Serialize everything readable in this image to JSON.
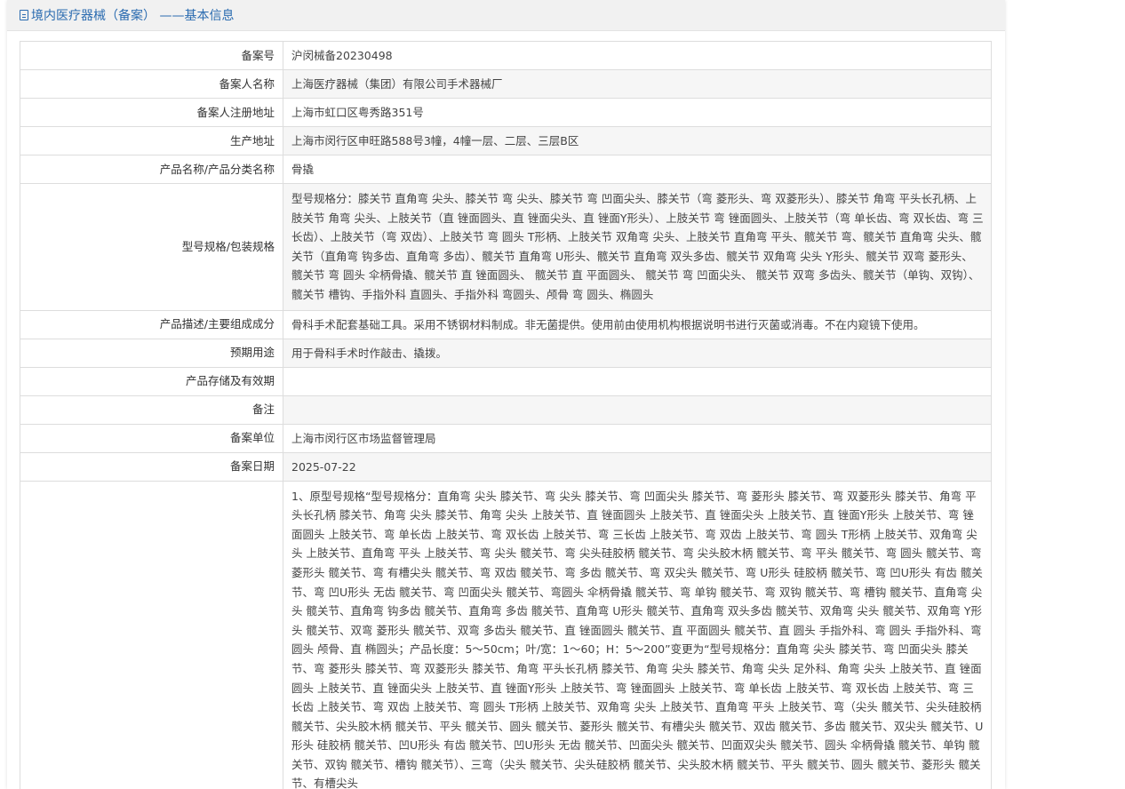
{
  "header": {
    "title": "境内医疗器械（备案） ——基本信息",
    "icon": "document-icon",
    "accent_color": "#2a6bb0"
  },
  "rows": [
    {
      "label": "备案号",
      "value": "沪闵械备20230498"
    },
    {
      "label": "备案人名称",
      "value": "上海医疗器械（集团）有限公司手术器械厂"
    },
    {
      "label": "备案人注册地址",
      "value": "上海市虹口区粤秀路351号"
    },
    {
      "label": "生产地址",
      "value": "上海市闵行区申旺路588号3幢，4幢一层、二层、三层B区"
    },
    {
      "label": "产品名称/产品分类名称",
      "value": "骨撬"
    },
    {
      "label": "型号规格/包装规格",
      "value": "型号规格分：膝关节 直角弯 尖头、膝关节 弯 尖头、膝关节 弯 凹面尖头、膝关节（弯 菱形头、弯 双菱形头）、膝关节 角弯 平头长孔柄、上肢关节 角弯 尖头、上肢关节（直 锉面圆头、直 锉面尖头、直 锉面Y形头）、上肢关节 弯 锉面圆头、上肢关节（弯 单长齿、弯 双长齿、弯 三长齿）、上肢关节（弯 双齿）、上肢关节 弯 圆头 T形柄、上肢关节 双角弯 尖头、上肢关节 直角弯 平头、髋关节 弯、髋关节 直角弯 尖头、髋关节（直角弯 钩多齿、直角弯 多齿）、髋关节 直角弯 U形头、髋关节 直角弯 双头多齿、髋关节 双角弯 尖头 Y形头、髋关节 双弯 菱形头、髋关节 弯 圆头 伞柄骨撬、髋关节 直 锉面圆头、 髋关节 直 平面圆头、 髋关节 弯 凹面尖头、 髋关节 双弯 多齿头、髋关节（单钩、双钩）、髋关节 槽钩、手指外科 直圆头、手指外科 弯圆头、颅骨 弯 圆头、椭圆头"
    },
    {
      "label": "产品描述/主要组成成分",
      "value": "骨科手术配套基础工具。采用不锈钢材料制成。非无菌提供。使用前由使用机构根据说明书进行灭菌或消毒。不在内窥镜下使用。"
    },
    {
      "label": "预期用途",
      "value": "用于骨科手术时作敲击、撬拨。"
    },
    {
      "label": "产品存储及有效期",
      "value": ""
    },
    {
      "label": "备注",
      "value": ""
    },
    {
      "label": "备案单位",
      "value": "上海市闵行区市场监督管理局"
    },
    {
      "label": "备案日期",
      "value": "2025-07-22"
    },
    {
      "label": "",
      "value": "1、原型号规格“型号规格分：直角弯 尖头 膝关节、弯 尖头 膝关节、弯 凹面尖头 膝关节、弯 菱形头 膝关节、弯 双菱形头 膝关节、角弯 平头长孔柄 膝关节、角弯 尖头 膝关节、角弯 尖头 上肢关节、直 锉面圆头 上肢关节、直 锉面尖头 上肢关节、直 锉面Y形头 上肢关节、弯 锉面圆头 上肢关节、弯 单长齿 上肢关节、弯 双长齿 上肢关节、弯 三长齿 上肢关节、弯 双齿 上肢关节、弯 圆头 T形柄 上肢关节、双角弯 尖头 上肢关节、直角弯 平头 上肢关节、弯 尖头 髋关节、弯 尖头硅胶柄 髋关节、弯 尖头胶木柄 髋关节、弯 平头 髋关节、弯 圆头 髋关节、弯 菱形头 髋关节、弯 有槽尖头 髋关节、弯 双齿 髋关节、弯 多齿 髋关节、弯 双尖头 髋关节、弯 U形头 硅胶柄 髋关节、弯 凹U形头 有齿 髋关节、弯 凹U形头 无齿 髋关节、弯 凹面尖头 髋关节、弯圆头 伞柄骨撬 髋关节、弯 单钩 髋关节、弯 双钩 髋关节、弯 槽钩 髋关节、直角弯 尖头 髋关节、直角弯 钩多齿 髋关节、直角弯 多齿 髋关节、直角弯 U形头 髋关节、直角弯 双头多齿 髋关节、双角弯 尖头 髋关节、双角弯 Y形头 髋关节、双弯 菱形头 髋关节、双弯 多齿头 髋关节、直 锉面圆头 髋关节、直 平面圆头 髋关节、直 圆头 手指外科、弯 圆头 手指外科、弯 圆头 颅骨、直 椭圆头；产品长度：5～50cm；叶/宽：1～60；H：5～200”变更为“型号规格分：直角弯 尖头 膝关节、弯 凹面尖头 膝关节、弯 菱形头 膝关节、弯 双菱形头 膝关节、角弯 平头长孔柄 膝关节、角弯 尖头 膝关节、角弯 尖头 足外科、角弯 尖头 上肢关节、直 锉面圆头 上肢关节、直 锉面尖头 上肢关节、直 锉面Y形头 上肢关节、弯 锉面圆头 上肢关节、弯 单长齿 上肢关节、弯 双长齿 上肢关节、弯 三长齿 上肢关节、弯 双齿 上肢关节、弯 圆头 T形柄 上肢关节、双角弯 尖头 上肢关节、直角弯 平头 上肢关节、弯（尖头 髋关节、尖头硅胶柄 髋关节、尖头胶木柄 髋关节、平头 髋关节、圆头 髋关节、菱形头 髋关节、有槽尖头 髋关节、双齿 髋关节、多齿 髋关节、双尖头 髋关节、U形头 硅胶柄 髋关节、凹U形头 有齿 髋关节、凹U形头 无齿 髋关节、凹面尖头 髋关节、凹面双尖头 髋关节、圆头 伞柄骨撬 髋关节、单钩 髋关节、双钩 髋关节、槽钩 髋关节）、三弯（尖头 髋关节、尖头硅胶柄 髋关节、尖头胶木柄 髋关节、平头 髋关节、圆头 髋关节、菱形头 髋关节、有槽尖头"
    }
  ]
}
